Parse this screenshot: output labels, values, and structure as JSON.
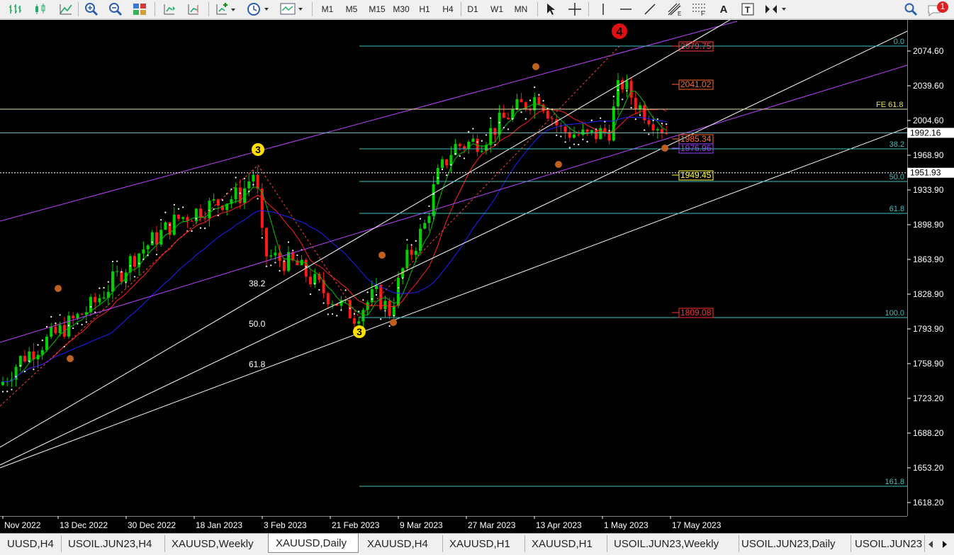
{
  "toolbar": {
    "timeframes": [
      "M1",
      "M5",
      "M15",
      "M30",
      "H1",
      "H4",
      "D1",
      "W1",
      "MN"
    ],
    "notification_count": "1"
  },
  "chart": {
    "symbol": "XAUUSD",
    "period": "Daily",
    "price_ticks": [
      "2074.60",
      "2039.60",
      "2004.60",
      "1968.90",
      "1933.90",
      "1898.90",
      "1863.90",
      "1828.90",
      "1793.90",
      "1758.90",
      "1723.20",
      "1688.20",
      "1653.20",
      "1618.20"
    ],
    "time_ticks": [
      "Nov 2022",
      "13 Dec 2022",
      "30 Dec 2022",
      "18 Jan 2023",
      "3 Feb 2023",
      "21 Feb 2023",
      "9 Mar 2023",
      "27 Mar 2023",
      "13 Apr 2023",
      "1 May 2023",
      "17 May 2023"
    ],
    "current_price": "1992.16",
    "dotted_level": "1951.93",
    "fibo_right": [
      "0.0",
      "38.2",
      "50.0",
      "61.8",
      "100.0",
      "161.8"
    ],
    "fibo_left": [
      "38.2",
      "50.0",
      "61.8"
    ],
    "fe_label": "FE 61.8",
    "fe_pct": "61.8",
    "price_labels": [
      "2079.75",
      "2041.02",
      "1985.34",
      "1976.96",
      "1949.45",
      "1809.08"
    ],
    "wave_labels": {
      "w3a": "3",
      "w3b": "3",
      "w4": "4"
    },
    "colors": {
      "bull": "#00d000",
      "bear": "#ff1a1a",
      "ma_fast": "#00c000",
      "ma_mid": "#ff2020",
      "ma_slow": "#2020ff",
      "channel": "#c040ff",
      "fibo": "#40c0c0",
      "trend": "#ffffff",
      "wave_minor": "#c06020",
      "wave_major3": "#ffe000",
      "wave_major4": "#e01010"
    }
  },
  "tabs": [
    "UUSD,H4",
    "USOIL.JUN23,H4",
    "XAUUSD,Weekly",
    "XAUUSD,Daily",
    "XAUUSD,H4",
    "XAUUSD,H1",
    "XAUUSD,H1",
    "USOIL.JUN23,Weekly",
    "USOIL.JUN23,Daily",
    "USOIL.JUN23"
  ],
  "active_tab_index": 3
}
